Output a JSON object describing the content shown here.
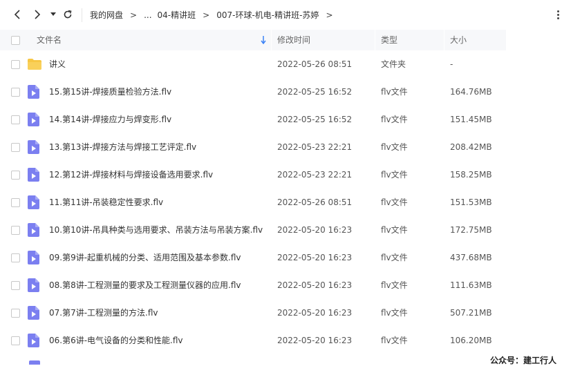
{
  "nav": {
    "back_icon": "chevron-left-icon",
    "forward_icon": "chevron-right-icon",
    "history_icon": "caret-down-icon",
    "refresh_icon": "refresh-icon"
  },
  "breadcrumb": {
    "items": [
      "我的网盘",
      "...",
      "04-精讲班",
      "007-环球-机电-精讲班-苏婷"
    ],
    "separator": ">"
  },
  "table": {
    "headers": {
      "name": "文件名",
      "time": "修改时间",
      "type": "类型",
      "size": "大小"
    },
    "rows": [
      {
        "name": "讲义",
        "time": "2022-05-26 08:51",
        "type": "文件夹",
        "size": "-",
        "icon": "folder-icon"
      },
      {
        "name": "15.第15讲-焊接质量检验方法.flv",
        "time": "2022-05-25 16:52",
        "type": "flv文件",
        "size": "164.76MB",
        "icon": "video-file-icon"
      },
      {
        "name": "14.第14讲-焊接应力与焊变形.flv",
        "time": "2022-05-25 16:52",
        "type": "flv文件",
        "size": "151.45MB",
        "icon": "video-file-icon"
      },
      {
        "name": "13.第13讲-焊接方法与焊接工艺评定.flv",
        "time": "2022-05-23 22:21",
        "type": "flv文件",
        "size": "208.42MB",
        "icon": "video-file-icon"
      },
      {
        "name": "12.第12讲-焊接材料与焊接设备选用要求.flv",
        "time": "2022-05-23 22:21",
        "type": "flv文件",
        "size": "158.25MB",
        "icon": "video-file-icon"
      },
      {
        "name": "11.第11讲-吊装稳定性要求.flv",
        "time": "2022-05-26 08:51",
        "type": "flv文件",
        "size": "151.53MB",
        "icon": "video-file-icon"
      },
      {
        "name": "10.第10讲-吊具种类与选用要求、吊装方法与吊装方案.flv",
        "time": "2022-05-20 16:23",
        "type": "flv文件",
        "size": "172.75MB",
        "icon": "video-file-icon"
      },
      {
        "name": "09.第9讲-起重机械的分类、适用范围及基本参数.flv",
        "time": "2022-05-20 16:23",
        "type": "flv文件",
        "size": "437.68MB",
        "icon": "video-file-icon"
      },
      {
        "name": "08.第8讲-工程测量的要求及工程测量仪器的应用.flv",
        "time": "2022-05-20 16:23",
        "type": "flv文件",
        "size": "111.63MB",
        "icon": "video-file-icon"
      },
      {
        "name": "07.第7讲-工程测量的方法.flv",
        "time": "2022-05-20 16:23",
        "type": "flv文件",
        "size": "507.21MB",
        "icon": "video-file-icon"
      },
      {
        "name": "06.第6讲-电气设备的分类和性能.flv",
        "time": "2022-05-20 16:23",
        "type": "flv文件",
        "size": "106.20MB",
        "icon": "video-file-icon"
      }
    ]
  },
  "watermark": "公众号：建工行人",
  "colors": {
    "folder": "#f7c744",
    "video": "#7b7ff0",
    "sort_arrow": "#3b82f6",
    "header_bg": "#f7f8fa"
  }
}
